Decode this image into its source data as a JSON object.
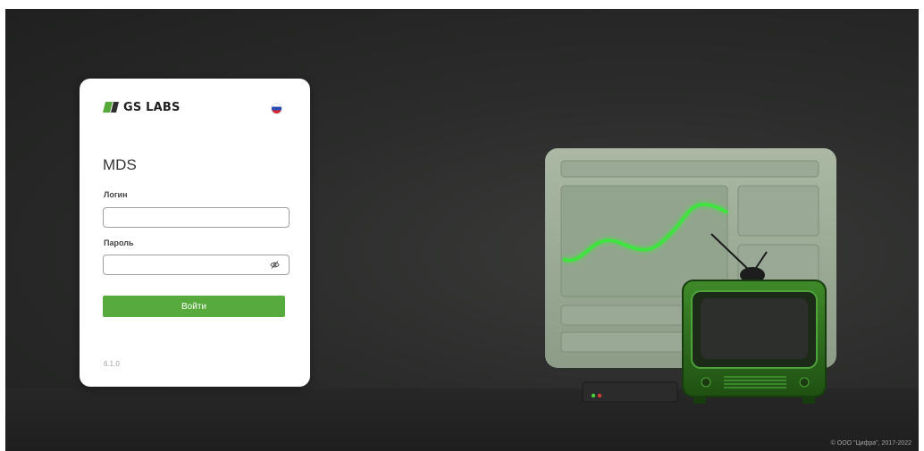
{
  "brand": {
    "name": "GS LABS"
  },
  "language": {
    "current": "Русский"
  },
  "login_form": {
    "app_title": "MDS",
    "login_label": "Логин",
    "login_value": "",
    "password_label": "Пароль",
    "password_value": "",
    "submit_label": "Войти",
    "version": "6.1.0"
  },
  "footer": {
    "copyright": "© ООО \"Цифра\", 2017-2022"
  },
  "colors": {
    "accent": "#56ab3c",
    "background": "#2b2c2b",
    "card": "#ffffff",
    "neon_green": "#3ee63e"
  },
  "icons": {
    "logo": "gs-labs-logo-icon",
    "flag": "russian-flag-icon",
    "password_toggle": "eye-off-icon"
  }
}
